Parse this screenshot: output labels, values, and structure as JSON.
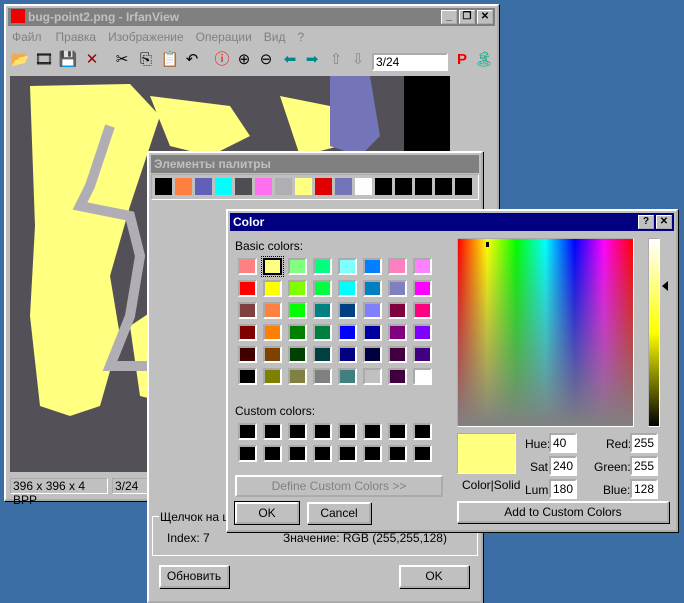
{
  "main": {
    "title": "bug-point2.png - IrfanView",
    "menu": [
      "Файл",
      "Правка",
      "Изображение",
      "Операции",
      "Вид",
      "?"
    ],
    "page_field": "3/24",
    "status": [
      "396 x 396 x 4 BPP",
      "3/24"
    ],
    "toolbar": [
      "open-icon",
      "slideshow-icon",
      "save-icon",
      "delete-icon",
      "cut-icon",
      "copy-icon",
      "paste-icon",
      "undo-icon",
      "info-icon",
      "zoom-in-icon",
      "zoom-out-icon",
      "prev-icon",
      "next-icon",
      "first-icon",
      "last-icon",
      "paint-icon",
      "about-icon"
    ]
  },
  "palette": {
    "title": "Элементы палитры",
    "colors": [
      "#000000",
      "#ff8040",
      "#6060b8",
      "#00ffff",
      "#504c54",
      "#ff70f0",
      "#b0aeb4",
      "#ffff80",
      "#e00000",
      "#7474b8",
      "#fcfffc",
      "#000000",
      "#000000",
      "#000000",
      "#000000",
      "#000000"
    ],
    "group_label": "Щелчок на цв",
    "index": "Index: 7",
    "value": "Значение: RGB (255,255,128)",
    "refresh": "Обновить",
    "ok": "OK"
  },
  "color": {
    "title": "Color",
    "basic_label": "Basic colors:",
    "custom_label": "Custom colors:",
    "define": "Define Custom Colors >>",
    "ok": "OK",
    "cancel": "Cancel",
    "color_solid": "Color|Solid",
    "add": "Add to Custom Colors",
    "basic": [
      "#ff8080",
      "#ffff80",
      "#80ff80",
      "#00ff80",
      "#80ffff",
      "#0080ff",
      "#ff80c0",
      "#ff80ff",
      "#ff0000",
      "#ffff00",
      "#80ff00",
      "#00ff40",
      "#00ffff",
      "#0080c0",
      "#8080c0",
      "#ff00ff",
      "#804040",
      "#ff8040",
      "#00ff00",
      "#008080",
      "#004080",
      "#8080ff",
      "#800040",
      "#ff0080",
      "#800000",
      "#ff8000",
      "#008000",
      "#008040",
      "#0000ff",
      "#0000a0",
      "#800080",
      "#8000ff",
      "#400000",
      "#804000",
      "#004000",
      "#004040",
      "#000080",
      "#000040",
      "#400040",
      "#400080",
      "#000000",
      "#808000",
      "#808040",
      "#808080",
      "#408080",
      "#c0c0c0",
      "#400040",
      "#ffffff"
    ],
    "selected_index": 1,
    "hue_label": "Hue:",
    "sat_label": "Sat:",
    "lum_label": "Lum:",
    "red_label": "Red:",
    "green_label": "Green:",
    "blue_label": "Blue:",
    "hue": "40",
    "sat": "240",
    "lum": "180",
    "red": "255",
    "green": "255",
    "blue": "128",
    "current": "#ffff80"
  }
}
